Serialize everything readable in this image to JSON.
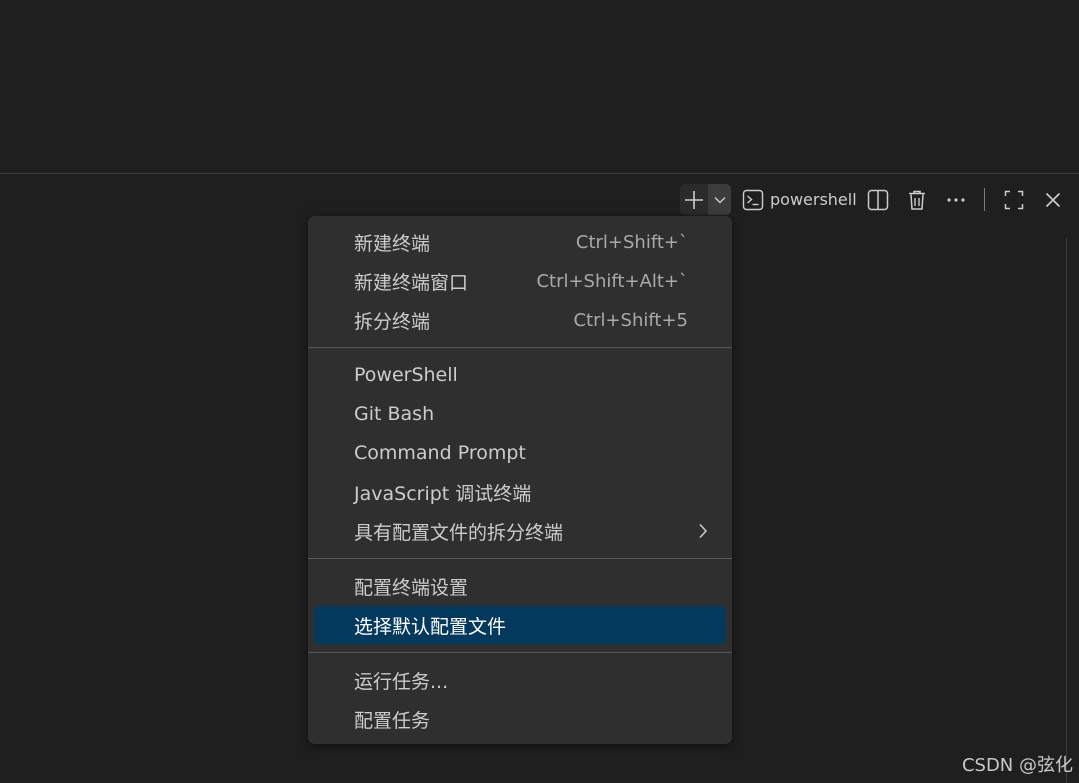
{
  "toolbar": {
    "new_terminal_icon": "plus-icon",
    "dropdown_icon": "chevron-down-icon",
    "terminal_icon": "terminal-icon",
    "terminal_name": "powershell",
    "split_icon": "split-icon",
    "trash_icon": "trash-icon",
    "more_icon": "ellipsis-icon",
    "maximize_icon": "maximize-icon",
    "close_icon": "close-icon"
  },
  "menu": {
    "group1": [
      {
        "label": "新建终端",
        "shortcut": "Ctrl+Shift+`"
      },
      {
        "label": "新建终端窗口",
        "shortcut": "Ctrl+Shift+Alt+`"
      },
      {
        "label": "拆分终端",
        "shortcut": "Ctrl+Shift+5"
      }
    ],
    "group2": [
      {
        "label": "PowerShell"
      },
      {
        "label": "Git Bash"
      },
      {
        "label": "Command Prompt"
      },
      {
        "label": "JavaScript 调试终端"
      },
      {
        "label": "具有配置文件的拆分终端",
        "submenu": true
      }
    ],
    "group3": [
      {
        "label": "配置终端设置"
      },
      {
        "label": "选择默认配置文件",
        "selected": true
      }
    ],
    "group4": [
      {
        "label": "运行任务..."
      },
      {
        "label": "配置任务"
      }
    ]
  },
  "colors": {
    "background": "#1f1f1f",
    "menu_background": "#2f2f2f",
    "selection": "#04395e",
    "text": "#cccccc"
  },
  "watermark": "CSDN @弦化"
}
